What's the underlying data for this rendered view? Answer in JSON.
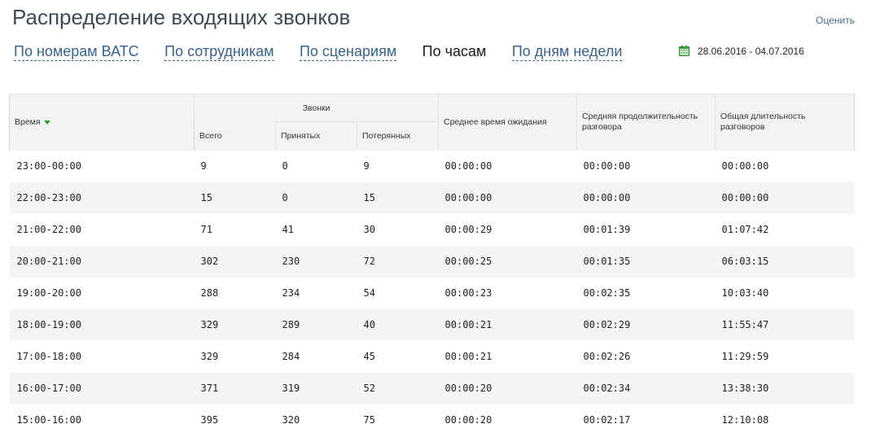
{
  "page": {
    "title": "Распределение входящих звонков",
    "rate_link": "Оценить"
  },
  "tabs": [
    {
      "label": "По номерам ВАТС",
      "active": false
    },
    {
      "label": "По сотрудникам",
      "active": false
    },
    {
      "label": "По сценариям",
      "active": false
    },
    {
      "label": "По часам",
      "active": true
    },
    {
      "label": "По дням недели",
      "active": false
    }
  ],
  "date_range": {
    "icon": "calendar-icon",
    "icon_color": "#2f9e2f",
    "value": "28.06.2016 - 04.07.2016"
  },
  "table": {
    "headers": {
      "time": "Время",
      "calls_group": "Звонки",
      "total": "Всего",
      "accepted": "Принятых",
      "lost": "Потерянных",
      "avg_wait": "Среднее время ожидания",
      "avg_duration": "Средняя продолжительность разговора",
      "total_duration": "Общая длительность разговоров"
    },
    "rows": [
      {
        "time": "23:00-00:00",
        "total": "9",
        "accepted": "0",
        "lost": "9",
        "avg_wait": "00:00:00",
        "avg_duration": "00:00:00",
        "total_duration": "00:00:00"
      },
      {
        "time": "22:00-23:00",
        "total": "15",
        "accepted": "0",
        "lost": "15",
        "avg_wait": "00:00:00",
        "avg_duration": "00:00:00",
        "total_duration": "00:00:00"
      },
      {
        "time": "21:00-22:00",
        "total": "71",
        "accepted": "41",
        "lost": "30",
        "avg_wait": "00:00:29",
        "avg_duration": "00:01:39",
        "total_duration": "01:07:42"
      },
      {
        "time": "20:00-21:00",
        "total": "302",
        "accepted": "230",
        "lost": "72",
        "avg_wait": "00:00:25",
        "avg_duration": "00:01:35",
        "total_duration": "06:03:15"
      },
      {
        "time": "19:00-20:00",
        "total": "288",
        "accepted": "234",
        "lost": "54",
        "avg_wait": "00:00:23",
        "avg_duration": "00:02:35",
        "total_duration": "10:03:40"
      },
      {
        "time": "18:00-19:00",
        "total": "329",
        "accepted": "289",
        "lost": "40",
        "avg_wait": "00:00:21",
        "avg_duration": "00:02:29",
        "total_duration": "11:55:47"
      },
      {
        "time": "17:00-18:00",
        "total": "329",
        "accepted": "284",
        "lost": "45",
        "avg_wait": "00:00:21",
        "avg_duration": "00:02:26",
        "total_duration": "11:29:59"
      },
      {
        "time": "16:00-17:00",
        "total": "371",
        "accepted": "319",
        "lost": "52",
        "avg_wait": "00:00:20",
        "avg_duration": "00:02:34",
        "total_duration": "13:38:30"
      },
      {
        "time": "15:00-16:00",
        "total": "395",
        "accepted": "320",
        "lost": "75",
        "avg_wait": "00:00:20",
        "avg_duration": "00:02:17",
        "total_duration": "12:10:08"
      }
    ]
  }
}
